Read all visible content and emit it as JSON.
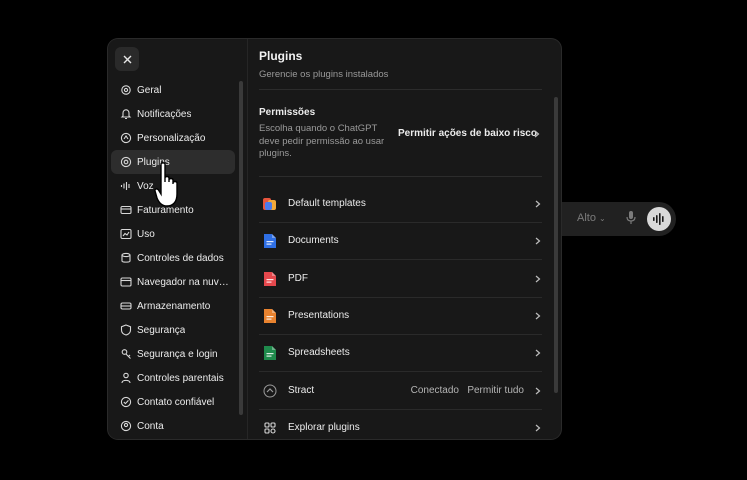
{
  "composer": {
    "model_label": "Alto",
    "icons": [
      "chevron-down-icon",
      "mic-icon",
      "voice-mode-icon"
    ]
  },
  "dialog": {
    "close_icon": "close-icon"
  },
  "sidebar": {
    "items": [
      {
        "label": "Geral",
        "icon": "gear-icon",
        "active": false
      },
      {
        "label": "Notificações",
        "icon": "bell-icon",
        "active": false
      },
      {
        "label": "Personalização",
        "icon": "personalization-icon",
        "active": false
      },
      {
        "label": "Plugins",
        "icon": "plugin-icon",
        "active": true
      },
      {
        "label": "Voz",
        "icon": "voice-icon",
        "active": false
      },
      {
        "label": "Faturamento",
        "icon": "card-icon",
        "active": false
      },
      {
        "label": "Uso",
        "icon": "usage-icon",
        "active": false
      },
      {
        "label": "Controles de dados",
        "icon": "database-icon",
        "active": false
      },
      {
        "label": "Navegador na nuvem",
        "icon": "cloud-browser-icon",
        "active": false
      },
      {
        "label": "Armazenamento",
        "icon": "storage-icon",
        "active": false
      },
      {
        "label": "Segurança",
        "icon": "shield-icon",
        "active": false
      },
      {
        "label": "Segurança e login",
        "icon": "login-security-icon",
        "active": false
      },
      {
        "label": "Controles parentais",
        "icon": "parental-icon",
        "active": false
      },
      {
        "label": "Contato confiável",
        "icon": "trusted-contact-icon",
        "active": false
      },
      {
        "label": "Conta",
        "icon": "account-icon",
        "active": false
      }
    ]
  },
  "main": {
    "title": "Plugins",
    "subtitle": "Gerencie os plugins instalados",
    "permissions": {
      "title": "Permissões",
      "description": "Escolha quando o ChatGPT deve pedir permissão ao usar plugins.",
      "action": "Permitir ações de baixo risco"
    },
    "plugins": [
      {
        "label": "Default templates",
        "icon": "templates-icon",
        "color": "#e8553d",
        "status": "",
        "action": ""
      },
      {
        "label": "Documents",
        "icon": "documents-icon",
        "color": "#2f6fe4",
        "status": "",
        "action": ""
      },
      {
        "label": "PDF",
        "icon": "pdf-icon",
        "color": "#e5484d",
        "status": "",
        "action": ""
      },
      {
        "label": "Presentations",
        "icon": "presentations-icon",
        "color": "#e9832f",
        "status": "",
        "action": ""
      },
      {
        "label": "Spreadsheets",
        "icon": "spreadsheets-icon",
        "color": "#1f8a4c",
        "status": "",
        "action": ""
      },
      {
        "label": "Stract",
        "icon": "stract-icon",
        "color": "#9a9a9a",
        "status": "Conectado",
        "action": "Permitir tudo"
      },
      {
        "label": "Explorar plugins",
        "icon": "explore-grid-icon",
        "color": "#cfcfcf",
        "status": "",
        "action": ""
      }
    ]
  },
  "colors": {
    "background": "#000000",
    "dialog": "#181818",
    "active_item": "#2d2d2d",
    "text": "#ececec",
    "muted": "#9a9a9a"
  }
}
